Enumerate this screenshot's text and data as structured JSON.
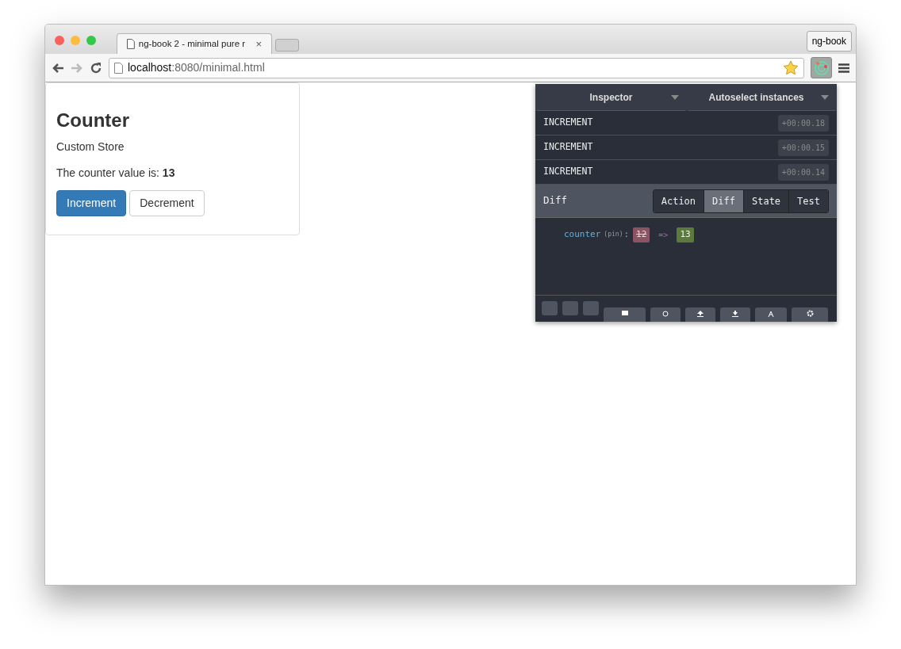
{
  "browser": {
    "tab": {
      "title": "ng-book 2 - minimal pure r",
      "close": "×"
    },
    "profile": "ng-book",
    "url": {
      "host": "localhost",
      "rest": ":8080/minimal.html"
    }
  },
  "page": {
    "heading": "Counter",
    "subtitle": "Custom Store",
    "value_line": "The counter value is: **13**",
    "buttons": [
      {
        "label": "Increment",
        "kind": "primary"
      },
      {
        "label": "Decrement",
        "kind": "default"
      }
    ]
  },
  "devtools": {
    "monitor": "Inspector",
    "instances": "Autoselect instances",
    "actions": [
      {
        "name": "INCREMENT",
        "time": "+00:00.18"
      },
      {
        "name": "INCREMENT",
        "time": "+00:00.15"
      },
      {
        "name": "INCREMENT",
        "time": "+00:00.14"
      }
    ],
    "section": "Diff",
    "tabs": [
      {
        "label": "Action",
        "selected": false
      },
      {
        "label": "Diff",
        "selected": true
      },
      {
        "label": "State",
        "selected": false
      },
      {
        "label": "Test",
        "selected": false
      }
    ],
    "diff": {
      "key": "counter",
      "note": "(pin)",
      "sep": ":",
      "old": "12",
      "arrow": "=>",
      "new": "13"
    }
  }
}
